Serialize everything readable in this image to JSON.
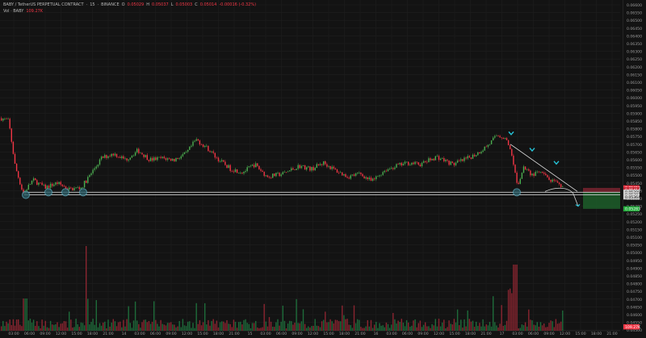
{
  "header": {
    "symbol": "BABY / TetherUS PERPETUAL CONTRACT",
    "interval": "15",
    "exchange": "BINANCE",
    "ohlc_prefix": "O",
    "o_label": "O",
    "o_value": "0.05029",
    "h_label": "H",
    "h_value": "0.05037",
    "l_label": "L",
    "l_value": "0.05003",
    "c_label": "C",
    "c_value": "0.05014",
    "change": "-0.00016 (-0.32%)",
    "volume_label": "Vol · BABY",
    "volume_value": "109.27K"
  },
  "colors": {
    "background": "#131313",
    "up": "#089981",
    "up_bright": "#4caf50",
    "down": "#f23645",
    "grid": "#1f1f1f",
    "axis_text": "#9a9a9a",
    "level_line": "#d0d0d0",
    "marker": "#5aa6b8",
    "arrow": "#26c6da",
    "sl_zone": "#7a2430",
    "tp_zone": "#1d5e2a"
  },
  "price_axis": {
    "labels": [
      "0.06600",
      "0.06550",
      "0.06500",
      "0.06450",
      "0.06400",
      "0.06350",
      "0.06300",
      "0.06250",
      "0.06200",
      "0.06150",
      "0.06100",
      "0.06050",
      "0.06000",
      "0.05950",
      "0.05900",
      "0.05850",
      "0.05800",
      "0.05750",
      "0.05700",
      "0.05650",
      "0.05600",
      "0.05550",
      "0.05500",
      "0.05450",
      "0.05400",
      "0.05350",
      "0.05300",
      "0.05250",
      "0.05200",
      "0.05150",
      "0.05100",
      "0.05050",
      "0.05000",
      "0.04950",
      "0.04900",
      "0.04850",
      "0.04800",
      "0.04750",
      "0.04700",
      "0.04650",
      "0.04600",
      "0.04550",
      "0.04500"
    ],
    "badges": [
      {
        "text": "0.05418",
        "bg": "#f23645",
        "fg": "#ffffff",
        "level": 0.05418
      },
      {
        "text": "0.05414",
        "bg": "#c62836",
        "fg": "#ffffff",
        "level": 0.05406
      },
      {
        "text": "0.05390",
        "bg": "#d0d0d0",
        "fg": "#111111",
        "level": 0.0539
      },
      {
        "text": "0.05383",
        "bg": "#d0d0d0",
        "fg": "#111111",
        "level": 0.05374
      },
      {
        "text": "0.05364",
        "bg": "#d0d0d0",
        "fg": "#111111",
        "level": 0.0536
      },
      {
        "text": "0.05283",
        "bg": "#22ab3a",
        "fg": "#ffffff",
        "level": 0.05283
      }
    ],
    "volume_badge": {
      "text": "109.27K",
      "bg": "#f23645",
      "fg": "#ffffff"
    }
  },
  "time_axis": {
    "labels": [
      "03:00",
      "06:00",
      "09:00",
      "12:00",
      "15:00",
      "18:00",
      "21:00",
      "14",
      "03:00",
      "06:00",
      "09:00",
      "12:00",
      "15:00",
      "18:00",
      "21:00",
      "15",
      "03:00",
      "06:00",
      "09:00",
      "12:00",
      "15:00",
      "18:00",
      "21:00",
      "16",
      "03:00",
      "06:00",
      "09:00",
      "12:00",
      "15:00",
      "18:00",
      "21:00",
      "17",
      "03:00",
      "06:00",
      "09:00",
      "12:00",
      "15:00",
      "18:00",
      "21:00"
    ]
  },
  "annotations": {
    "support_levels": [
      0.0539,
      0.05373
    ],
    "support_markers": 6,
    "trendline_touches": 3,
    "downtrend_points": 3,
    "trade_setup": {
      "entry": 0.0539,
      "stop": 0.05418,
      "target": 0.05283
    }
  }
}
